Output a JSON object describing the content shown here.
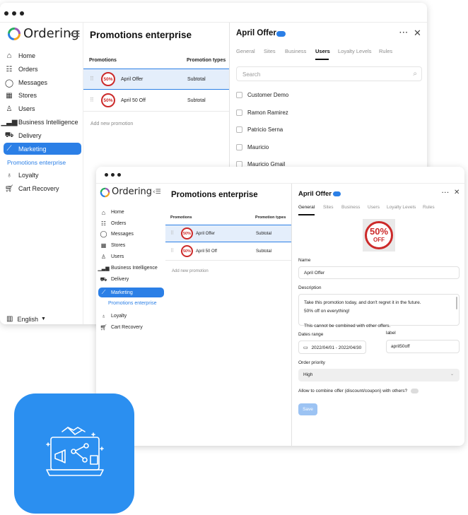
{
  "sidebar": {
    "logo_text": "Ordering",
    "items": [
      {
        "label": "Home",
        "icon": "home-icon"
      },
      {
        "label": "Orders",
        "icon": "list-icon"
      },
      {
        "label": "Messages",
        "icon": "chat-icon"
      },
      {
        "label": "Stores",
        "icon": "store-icon"
      },
      {
        "label": "Users",
        "icon": "users-icon"
      },
      {
        "label": "Business Intelligence",
        "icon": "bar-chart-icon"
      },
      {
        "label": "Delivery",
        "icon": "truck-icon"
      },
      {
        "label": "Marketing",
        "icon": "line-chart-icon"
      },
      {
        "label": "Loyalty",
        "icon": "badge-icon"
      },
      {
        "label": "Cart Recovery",
        "icon": "cart-icon"
      }
    ],
    "sub_item": "Promotions enterprise",
    "language": "English"
  },
  "main": {
    "title": "Promotions enterprise",
    "columns": [
      "Promotions",
      "Promotion types"
    ],
    "rows": [
      {
        "name": "April Offer",
        "type": "Subtotal",
        "badge": "50%"
      },
      {
        "name": "April 50 Off",
        "type": "Subtotal",
        "badge": "50%"
      }
    ],
    "add_link": "Add new promotion"
  },
  "panel": {
    "title": "April Offer",
    "tabs": [
      "General",
      "Sites",
      "Business",
      "Users",
      "Loyalty Levels",
      "Rules"
    ],
    "search_placeholder": "Search",
    "users": [
      "Customer Demo",
      "Ramon Ramirez",
      "Patricio Serna",
      "Mauricio",
      "Mauricio Gmail"
    ],
    "image_text_top": "50%",
    "image_text_bottom": "OFF",
    "name_label": "Name",
    "name_value": "April Offer",
    "description_label": "Description",
    "description_lines": [
      "Take this promotion today, and don't regret it in the future.",
      "50% off on everything!",
      "",
      "This cannot be combined with other offers."
    ],
    "dates_label": "Dates range",
    "dates_value": "2022/04/01 - 2022/04/30",
    "label_label": "label",
    "label_value": "april50off",
    "priority_label": "Order priority",
    "priority_value": "High",
    "combine_label": "Allow to combine offer (discount/coupon) with others?",
    "save_label": "Save"
  },
  "colors": {
    "accent": "#2b7fe6",
    "tile": "#2b8ff0",
    "badge": "#cc2a2a"
  }
}
